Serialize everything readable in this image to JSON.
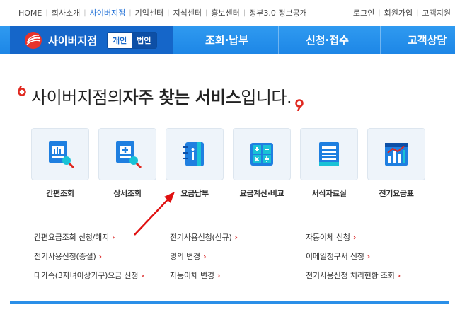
{
  "topnav": [
    "HOME",
    "회사소개",
    "사이버지점",
    "기업센터",
    "지식센터",
    "홍보센터",
    "정부3.0 정보공개"
  ],
  "usernav": [
    "로그인",
    "회원가입",
    "고객지원"
  ],
  "brand": {
    "name": "사이버지점",
    "seg_personal": "개인",
    "seg_corporate": "법인"
  },
  "mainmenu": [
    "조회·납부",
    "신청·접수",
    "고객상담"
  ],
  "headline": {
    "pre": "사이버지점의 ",
    "bold1": "자주 찾는 서비스",
    "post": "입니다."
  },
  "tiles": [
    {
      "label": "간편조회",
      "icon": "quick-search-icon"
    },
    {
      "label": "상세조회",
      "icon": "detail-search-icon"
    },
    {
      "label": "요금납부",
      "icon": "payment-book-icon"
    },
    {
      "label": "요금계산·비교",
      "icon": "calculator-icon"
    },
    {
      "label": "서식자료실",
      "icon": "form-document-icon"
    },
    {
      "label": "전기요금표",
      "icon": "rate-chart-icon"
    }
  ],
  "links": {
    "col1": [
      "간편요금조회 신청/해지",
      "전기사용신청(증설)",
      "대가족(3자녀이상가구)요금 신청"
    ],
    "col2": [
      "전기사용신청(신규)",
      "명의 변경",
      "자동이체 변경"
    ],
    "col3": [
      "자동이체 신청",
      "이메일청구서 신청",
      "전기사용신청 처리현황 조회"
    ]
  },
  "arrow_glyph": "›",
  "colors": {
    "accent": "#1d86e6",
    "brand_dark": "#1566c9",
    "link_arrow": "#dd3333",
    "annotation": "#e01010"
  }
}
